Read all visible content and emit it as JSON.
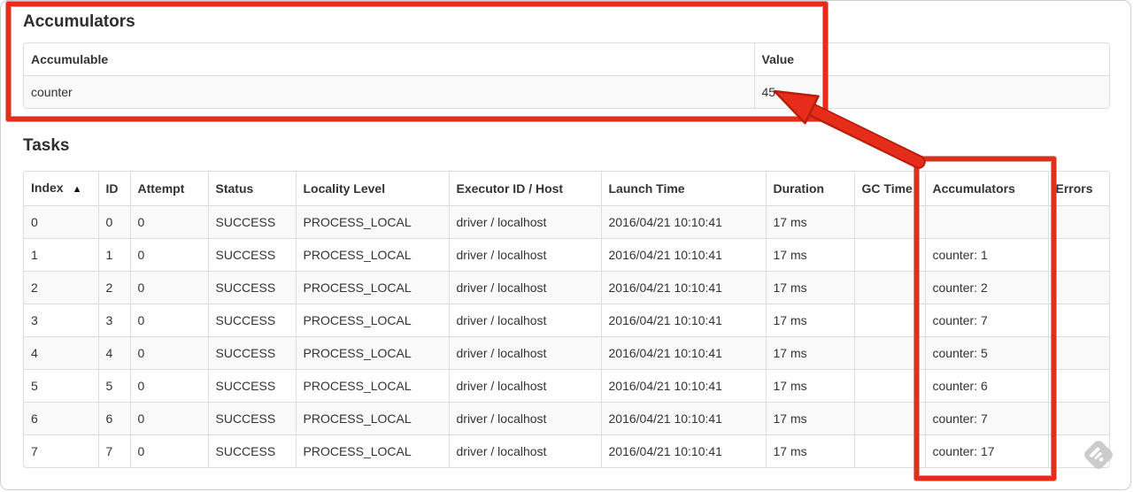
{
  "annotation_color": "#e62d19",
  "accumulators_section": {
    "title": "Accumulators",
    "table": {
      "columns": [
        "Accumulable",
        "Value"
      ],
      "rows": [
        [
          "counter",
          "45"
        ]
      ]
    }
  },
  "tasks_section": {
    "title": "Tasks",
    "table": {
      "sort": {
        "column": "Index",
        "direction": "ascending",
        "icon": "▲"
      },
      "columns": [
        "Index",
        "ID",
        "Attempt",
        "Status",
        "Locality Level",
        "Executor ID / Host",
        "Launch Time",
        "Duration",
        "GC Time",
        "Accumulators",
        "Errors"
      ],
      "rows": [
        [
          "0",
          "0",
          "0",
          "SUCCESS",
          "PROCESS_LOCAL",
          "driver / localhost",
          "2016/04/21 10:10:41",
          "17 ms",
          "",
          "",
          ""
        ],
        [
          "1",
          "1",
          "0",
          "SUCCESS",
          "PROCESS_LOCAL",
          "driver / localhost",
          "2016/04/21 10:10:41",
          "17 ms",
          "",
          "counter: 1",
          ""
        ],
        [
          "2",
          "2",
          "0",
          "SUCCESS",
          "PROCESS_LOCAL",
          "driver / localhost",
          "2016/04/21 10:10:41",
          "17 ms",
          "",
          "counter: 2",
          ""
        ],
        [
          "3",
          "3",
          "0",
          "SUCCESS",
          "PROCESS_LOCAL",
          "driver / localhost",
          "2016/04/21 10:10:41",
          "17 ms",
          "",
          "counter: 7",
          ""
        ],
        [
          "4",
          "4",
          "0",
          "SUCCESS",
          "PROCESS_LOCAL",
          "driver / localhost",
          "2016/04/21 10:10:41",
          "17 ms",
          "",
          "counter: 5",
          ""
        ],
        [
          "5",
          "5",
          "0",
          "SUCCESS",
          "PROCESS_LOCAL",
          "driver / localhost",
          "2016/04/21 10:10:41",
          "17 ms",
          "",
          "counter: 6",
          ""
        ],
        [
          "6",
          "6",
          "0",
          "SUCCESS",
          "PROCESS_LOCAL",
          "driver / localhost",
          "2016/04/21 10:10:41",
          "17 ms",
          "",
          "counter: 7",
          ""
        ],
        [
          "7",
          "7",
          "0",
          "SUCCESS",
          "PROCESS_LOCAL",
          "driver / localhost",
          "2016/04/21 10:10:41",
          "17 ms",
          "",
          "counter: 17",
          ""
        ]
      ]
    }
  },
  "watermark": {
    "icon": "feedly-logo"
  }
}
